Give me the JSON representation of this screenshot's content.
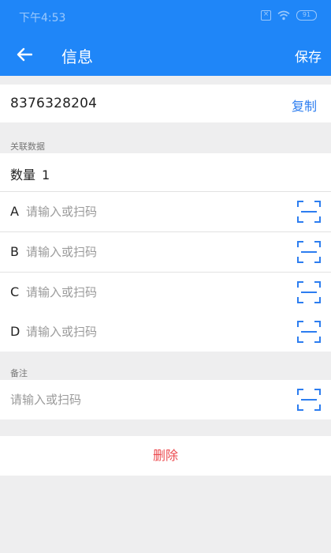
{
  "status_bar": {
    "time": "下午4:53",
    "battery": "91"
  },
  "header": {
    "title": "信息",
    "save_label": "保存"
  },
  "record": {
    "id": "8376328204",
    "copy_label": "复制"
  },
  "linked_data": {
    "section_label": "关联数据",
    "count_label": "数量",
    "count_value": "1",
    "fields": [
      {
        "letter": "A",
        "placeholder": "请输入或扫码"
      },
      {
        "letter": "B",
        "placeholder": "请输入或扫码"
      },
      {
        "letter": "C",
        "placeholder": "请输入或扫码"
      },
      {
        "letter": "D",
        "placeholder": "请输入或扫码"
      }
    ]
  },
  "notes": {
    "section_label": "备注",
    "placeholder": "请输入或扫码"
  },
  "actions": {
    "delete_label": "删除"
  },
  "colors": {
    "primary": "#1f86f8",
    "link": "#2c7df0",
    "danger": "#ec4b4f",
    "background": "#eeeeef"
  },
  "icons": {
    "back": "arrow-left-icon",
    "scan": "scan-icon"
  }
}
